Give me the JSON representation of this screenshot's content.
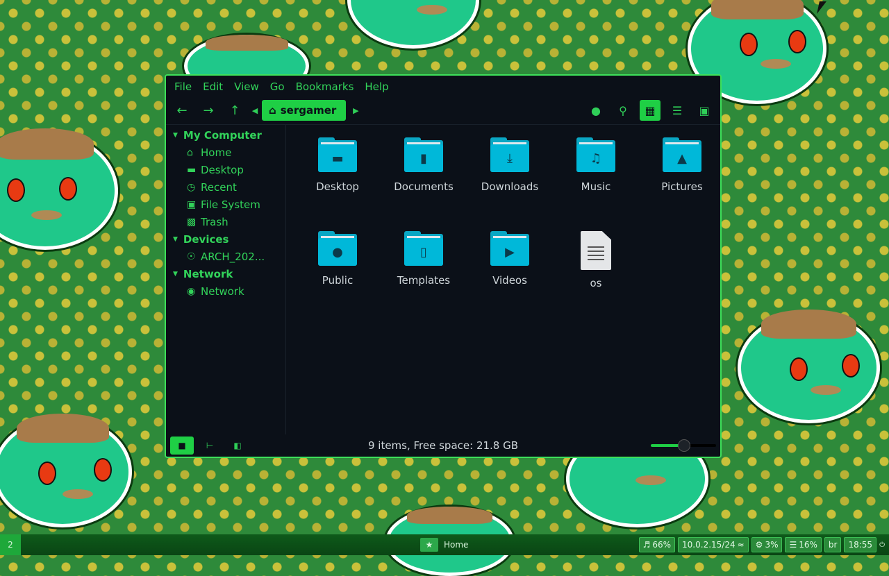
{
  "window": {
    "menu": [
      "File",
      "Edit",
      "View",
      "Go",
      "Bookmarks",
      "Help"
    ],
    "breadcrumb": "sergamer",
    "toolbar_icons": [
      "back-icon",
      "forward-icon",
      "up-icon",
      "location-icon",
      "search-icon",
      "icon-view-icon",
      "list-view-icon",
      "compact-view-icon"
    ],
    "sidebar": {
      "sections": [
        {
          "title": "My Computer",
          "items": [
            {
              "label": "Home",
              "icon": "home-icon"
            },
            {
              "label": "Desktop",
              "icon": "desktop-icon"
            },
            {
              "label": "Recent",
              "icon": "clock-icon"
            },
            {
              "label": "File System",
              "icon": "drive-icon"
            },
            {
              "label": "Trash",
              "icon": "trash-icon"
            }
          ]
        },
        {
          "title": "Devices",
          "items": [
            {
              "label": "ARCH_202...",
              "icon": "disc-icon"
            }
          ]
        },
        {
          "title": "Network",
          "items": [
            {
              "label": "Network",
              "icon": "globe-icon"
            }
          ]
        }
      ]
    },
    "files": [
      {
        "name": "Desktop",
        "kind": "folder",
        "icon": "desktop"
      },
      {
        "name": "Documents",
        "kind": "folder",
        "icon": "document"
      },
      {
        "name": "Downloads",
        "kind": "folder",
        "icon": "download"
      },
      {
        "name": "Music",
        "kind": "folder",
        "icon": "music"
      },
      {
        "name": "Pictures",
        "kind": "folder",
        "icon": "picture"
      },
      {
        "name": "Public",
        "kind": "folder",
        "icon": "person"
      },
      {
        "name": "Templates",
        "kind": "folder",
        "icon": "template"
      },
      {
        "name": "Videos",
        "kind": "folder",
        "icon": "video"
      },
      {
        "name": "os",
        "kind": "text-file",
        "icon": "text"
      }
    ],
    "status": "9 items, Free space: 21.8 GB",
    "zoom_level": 0.5
  },
  "taskbar": {
    "workspace": "2",
    "task_label": "Home",
    "volume": "66%",
    "network": "10.0.2.15/24",
    "cpu": "3%",
    "memory": "16%",
    "layout": "br",
    "clock": "18:55"
  },
  "colors": {
    "accent": "#1fcf45",
    "folder": "#00b8d9",
    "window_bg": "#0b1018",
    "window_border": "#3ee05a"
  }
}
